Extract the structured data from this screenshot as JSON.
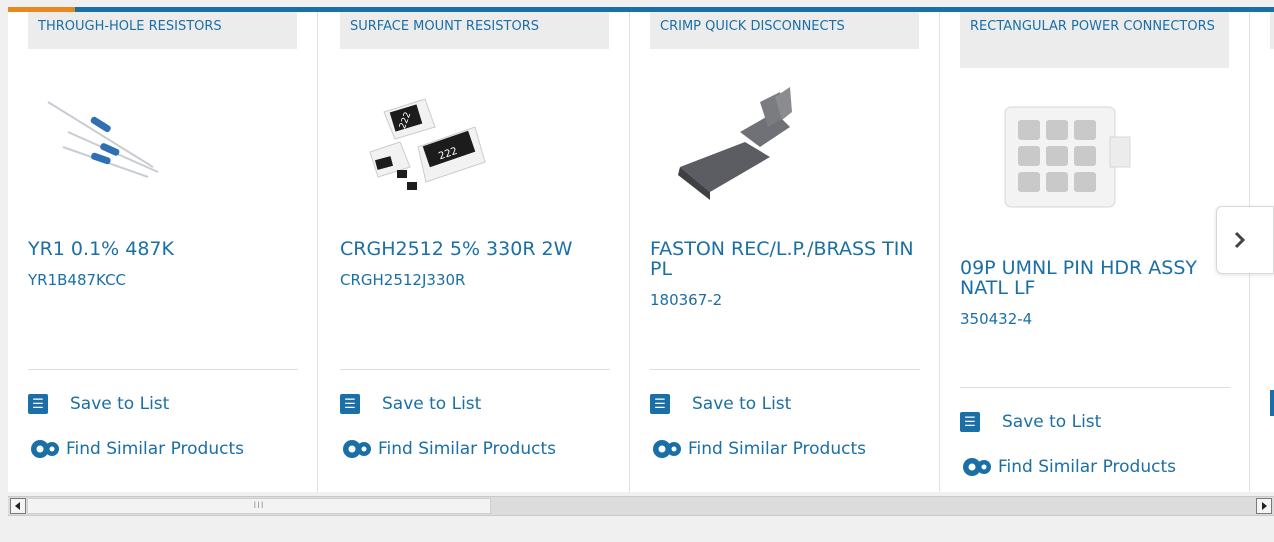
{
  "cards": [
    {
      "category": "THROUGH-HOLE RESISTORS",
      "image_icon": "axial-resistor-image",
      "name": "YR1 0.1% 487K",
      "part_number": "YR1B487KCC",
      "save_label": "Save to List",
      "similar_label": "Find Similar Products"
    },
    {
      "category": "SURFACE MOUNT RESISTORS",
      "image_icon": "smd-resistor-image",
      "name": "CRGH2512 5% 330R 2W",
      "part_number": "CRGH2512J330R",
      "save_label": "Save to List",
      "similar_label": "Find Similar Products",
      "chip_label_1": "222",
      "chip_label_2": "222"
    },
    {
      "category": "CRIMP QUICK DISCONNECTS",
      "image_icon": "quick-disconnect-image",
      "name": "FASTON REC/L.P./BRASS TIN PL",
      "part_number": "180367-2",
      "save_label": "Save to List",
      "similar_label": "Find Similar Products"
    },
    {
      "category": "RECTANGULAR POWER CONNECTORS",
      "image_icon": "power-connector-image",
      "name": "09P UMNL PIN HDR ASSY NATL LF",
      "part_number": "350432-4",
      "save_label": "Save to List",
      "similar_label": "Find Similar Products"
    }
  ],
  "carousel": {
    "next_icon": "chevron-right-icon"
  },
  "colors": {
    "brand": "#1a6fa6",
    "accent": "#e8891f",
    "category_bg": "#ececec"
  },
  "scrollbar": {
    "left_icon": "scroll-left-arrow",
    "right_icon": "scroll-right-arrow"
  }
}
